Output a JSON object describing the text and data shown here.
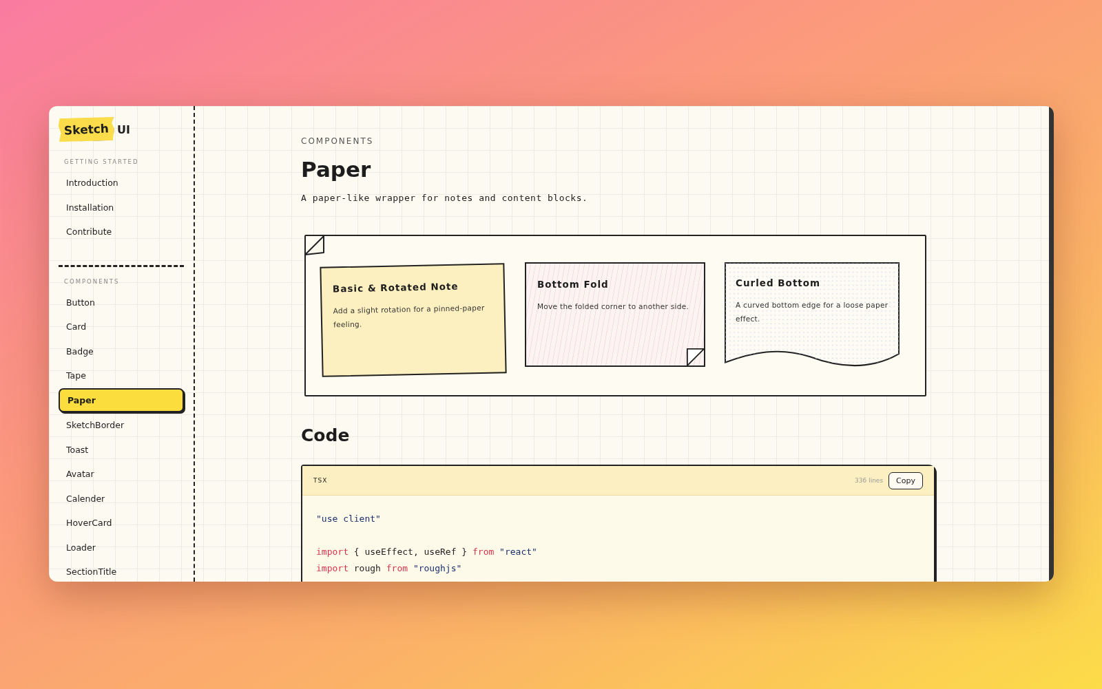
{
  "logo": {
    "tape_text": "Sketch",
    "text": "UI"
  },
  "sidebar": {
    "sections": [
      {
        "label": "GETTING STARTED",
        "items": [
          {
            "label": "Introduction",
            "selected": false
          },
          {
            "label": "Installation",
            "selected": false
          },
          {
            "label": "Contribute",
            "selected": false
          }
        ]
      },
      {
        "label": "COMPONENTS",
        "items": [
          {
            "label": "Button",
            "selected": false
          },
          {
            "label": "Card",
            "selected": false
          },
          {
            "label": "Badge",
            "selected": false
          },
          {
            "label": "Tape",
            "selected": false
          },
          {
            "label": "Paper",
            "selected": true
          },
          {
            "label": "SketchBorder",
            "selected": false
          },
          {
            "label": "Toast",
            "selected": false
          },
          {
            "label": "Avatar",
            "selected": false
          },
          {
            "label": "Calender",
            "selected": false
          },
          {
            "label": "HoverCard",
            "selected": false
          },
          {
            "label": "Loader",
            "selected": false
          },
          {
            "label": "SectionTitle",
            "selected": false
          }
        ]
      }
    ]
  },
  "page": {
    "eyebrow": "COMPONENTS",
    "title": "Paper",
    "description": "A paper-like wrapper for notes and content blocks."
  },
  "demo": {
    "cards": [
      {
        "kind": "rotated",
        "title": "Basic & Rotated Note",
        "text": "Add a slight rotation for a pinned-paper feeling."
      },
      {
        "kind": "fold",
        "title": "Bottom Fold",
        "text": "Move the folded corner to another side."
      },
      {
        "kind": "curl",
        "title": "Curled Bottom",
        "text": "A curved bottom edge for a loose paper effect."
      }
    ]
  },
  "code_section": {
    "title": "Code",
    "language": "TSX",
    "line_count": "336 lines",
    "copy_button": "Copy",
    "lines": [
      {
        "kind": "code",
        "tokens": [
          {
            "kind": "string",
            "text": "\"use client\""
          }
        ]
      },
      {
        "kind": "blank"
      },
      {
        "kind": "code",
        "tokens": [
          {
            "kind": "keyword",
            "text": "import"
          },
          {
            "kind": "plain",
            "text": " { useEffect, useRef } "
          },
          {
            "kind": "keyword",
            "text": "from"
          },
          {
            "kind": "string",
            "text": "\"react\""
          }
        ]
      },
      {
        "kind": "code",
        "tokens": [
          {
            "kind": "keyword",
            "text": "import"
          },
          {
            "kind": "plain",
            "text": " rough "
          },
          {
            "kind": "keyword",
            "text": "from"
          },
          {
            "kind": "string",
            "text": "\"roughjs\""
          }
        ]
      }
    ]
  }
}
